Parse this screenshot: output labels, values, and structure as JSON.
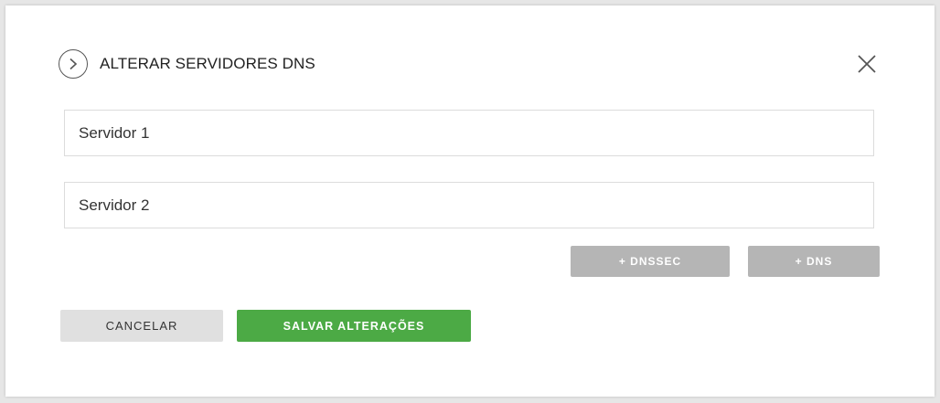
{
  "dialog": {
    "title": "ALTERAR SERVIDORES DNS",
    "icons": {
      "header": "chevron-right-circle-icon",
      "close": "close-icon"
    }
  },
  "fields": {
    "server1_placeholder": "Servidor 1",
    "server2_placeholder": "Servidor 2"
  },
  "actions": {
    "add_dnssec_label": "+ DNSSEC",
    "add_dns_label": "+ DNS",
    "cancel_label": "CANCELAR",
    "save_label": "SALVAR ALTERAÇÕES"
  },
  "colors": {
    "primary": "#4caa45",
    "secondary_button": "#b5b5b5",
    "cancel_button": "#e0e0e0"
  }
}
